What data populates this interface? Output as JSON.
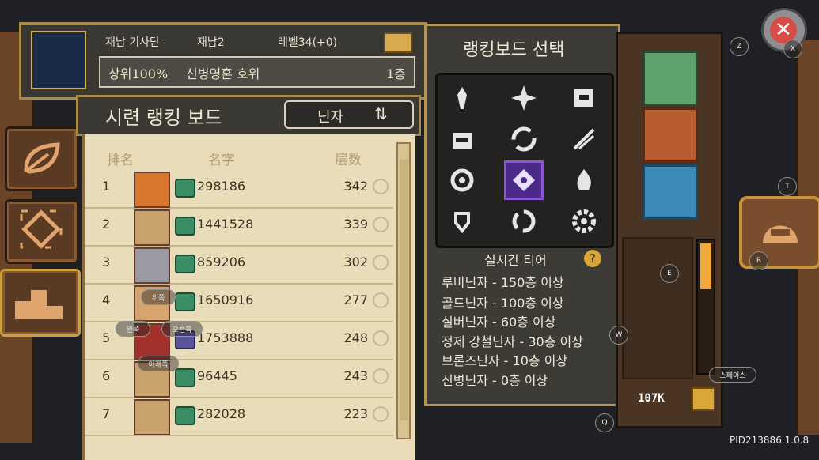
{
  "header": {
    "guild": "재남 기사단",
    "player": "재남2",
    "level": "레벨34(+0)",
    "percentile": "상위100%",
    "title": "신병영혼 호위",
    "floor": "1층"
  },
  "board": {
    "title": "시련 랭킹 보드",
    "selector": "닌자",
    "columns": [
      "排名",
      "名字",
      "层数"
    ],
    "rows": [
      {
        "rank": "1",
        "name": "298186",
        "floor": "342"
      },
      {
        "rank": "2",
        "name": "1441528",
        "floor": "339"
      },
      {
        "rank": "3",
        "name": "859206",
        "floor": "302"
      },
      {
        "rank": "4",
        "name": "1650916",
        "floor": "277"
      },
      {
        "rank": "5",
        "name": "1753888",
        "floor": "248"
      },
      {
        "rank": "6",
        "name": "96445",
        "floor": "243"
      },
      {
        "rank": "7",
        "name": "282028",
        "floor": "223"
      }
    ]
  },
  "selector_panel": {
    "title": "랭킹보드 선택",
    "icons": [
      "dagger-crest-icon",
      "diamond-star-icon",
      "helmet-icon",
      "castle-icon",
      "swirl-icon",
      "crossed-blades-icon",
      "gear-flower-icon",
      "rune-square-icon",
      "flame-icon",
      "shield-wings-icon",
      "vortex-icon",
      "gear-icon"
    ],
    "selected_index": 7,
    "tier_heading": "실시간 티어",
    "tiers": [
      "루비닌자 - 150층 이상",
      "골드닌자 - 100층 이상",
      "실버닌자 - 60층 이상",
      "정제 강철닌자 - 30층 이상",
      "브론즈닌자 - 10층 이상",
      "신병닌자 - 0층 이상"
    ]
  },
  "inventory": {
    "currency": "107K"
  },
  "overlay_keys": {
    "z": "Z",
    "x": "X",
    "t": "T",
    "r": "R",
    "e": "E",
    "w": "W",
    "q": "Q",
    "space": "스페이스",
    "left": "왼쪽",
    "right": "오른쪽",
    "up": "위쪽",
    "down": "아래쪽"
  },
  "version": "PID213886 1.0.8"
}
